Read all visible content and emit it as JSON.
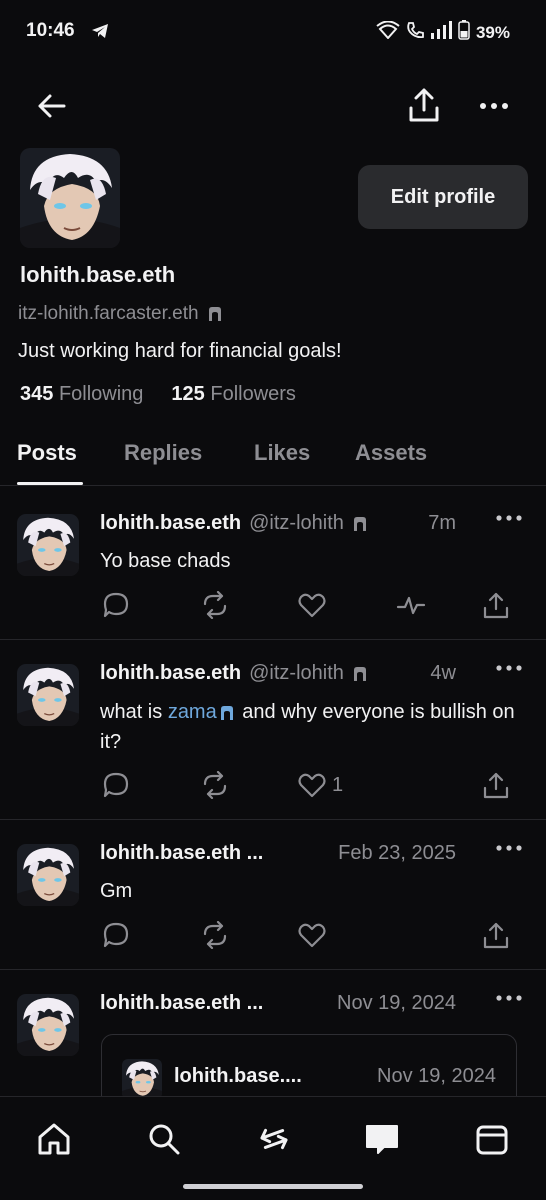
{
  "status": {
    "time": "10:46",
    "battery": "39%"
  },
  "profile": {
    "display_name": "lohith.base.eth",
    "handle": "itz-lohith.farcaster.eth",
    "bio": "Just working hard for financial goals!",
    "following_count": "345",
    "following_label": "Following",
    "followers_count": "125",
    "followers_label": "Followers",
    "edit_label": "Edit profile"
  },
  "tabs": [
    {
      "label": "Posts",
      "active": true
    },
    {
      "label": "Replies",
      "active": false
    },
    {
      "label": "Likes",
      "active": false
    },
    {
      "label": "Assets",
      "active": false
    }
  ],
  "posts": [
    {
      "name": "lohith.base.eth",
      "username": "@itz-lohith",
      "time": "7m",
      "text": "Yo base chads",
      "likes": ""
    },
    {
      "name": "lohith.base.eth",
      "username": "@itz-lohith",
      "time": "4w",
      "text_before": "what is ",
      "mention": "zama",
      "text_after": " and why everyone is bullish on it?",
      "likes": "1"
    },
    {
      "name": "lohith.base.eth ...",
      "username": "",
      "time": "Feb 23, 2025",
      "text": "Gm",
      "likes": ""
    },
    {
      "name": "lohith.base.eth ...",
      "username": "",
      "time": "Nov 19, 2024",
      "text": "",
      "quote": {
        "name": "lohith.base....",
        "time": "Nov 19, 2024"
      }
    }
  ],
  "icons": {
    "accent": "#6fa8dc",
    "background": "#0b0b0d",
    "muted": "#8e8e93"
  }
}
